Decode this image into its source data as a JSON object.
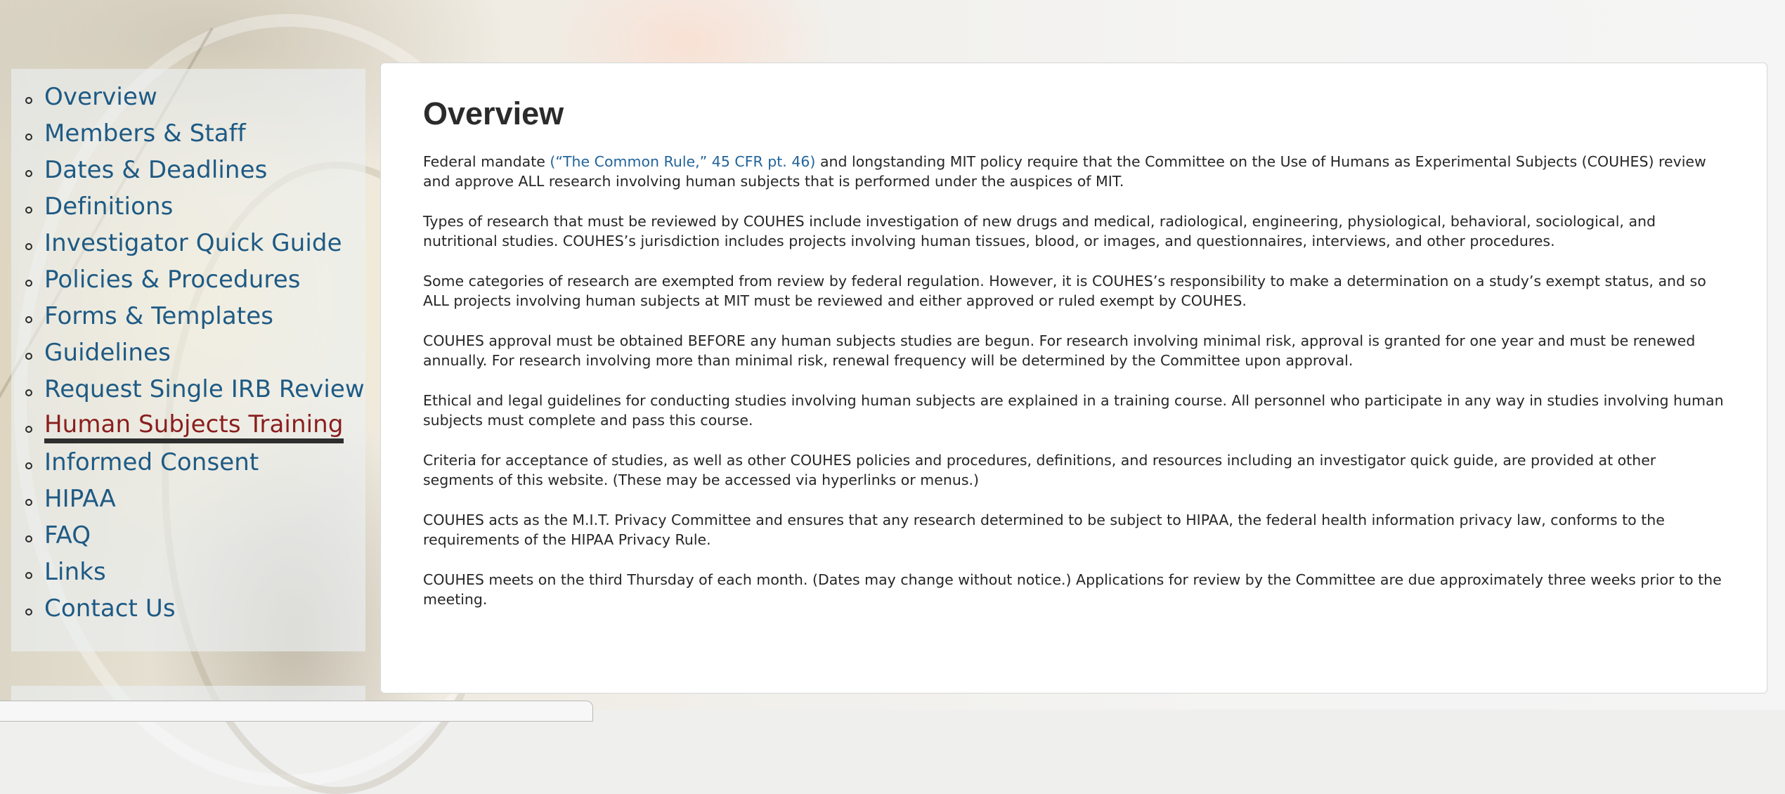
{
  "sidebar": {
    "items": [
      {
        "label": "Overview"
      },
      {
        "label": "Members & Staff"
      },
      {
        "label": "Dates & Deadlines"
      },
      {
        "label": "Definitions"
      },
      {
        "label": "Investigator Quick Guide"
      },
      {
        "label": "Policies & Procedures"
      },
      {
        "label": "Forms & Templates"
      },
      {
        "label": "Guidelines"
      },
      {
        "label": "Request Single IRB Review"
      },
      {
        "label": "Human Subjects Training"
      },
      {
        "label": "Informed Consent"
      },
      {
        "label": "HIPAA"
      },
      {
        "label": "FAQ"
      },
      {
        "label": "Links"
      },
      {
        "label": "Contact Us"
      }
    ],
    "active_item": "Human Subjects Training"
  },
  "main": {
    "title": "Overview",
    "p1": {
      "before": "Federal mandate ",
      "link": "(“The Common Rule,” 45 CFR pt. 46)",
      "after": " and longstanding MIT policy require that the Committee on the Use of Humans as Experimental Subjects (COUHES) review and approve ALL research involving human subjects that is performed under the auspices of MIT."
    },
    "p2": "Types of research that must be reviewed by COUHES include investigation of new drugs and medical, radiological, engineering, physiological, behavioral, sociological, and nutritional studies. COUHES’s jurisdiction includes projects involving human tissues, blood, or images, and questionnaires, interviews, and other procedures.",
    "p3": "Some categories of research are exempted from review by federal regulation. However, it is COUHES’s responsibility to make a determination on a study’s exempt status, and so ALL projects involving human subjects at MIT must be reviewed and either approved or ruled exempt by COUHES.",
    "p4": "COUHES approval must be obtained BEFORE any human subjects studies are begun. For research involving minimal risk, approval is granted for one year and must be renewed annually. For research involving more than minimal risk, renewal frequency will be determined by the Committee upon approval.",
    "p5": "Ethical and legal guidelines for conducting studies involving human subjects are explained in a training course. All personnel who participate in any way in studies involving human subjects must complete and pass this course.",
    "p6": "Criteria for acceptance of studies, as well as other COUHES policies and procedures, definitions, and resources including an investigator quick guide, are provided at other segments of this website. (These may be accessed via hyperlinks or menus.)",
    "p7": "COUHES acts as the M.I.T. Privacy Committee and ensures that any research determined to be subject to HIPAA, the federal health information privacy law, conforms to the requirements of the HIPAA Privacy Rule.",
    "p8": "COUHES meets on the third Thursday of each month. (Dates may change without notice.) Applications for review by the Committee are due approximately three weeks prior to the meeting."
  },
  "colors": {
    "link": "#1e5a84",
    "active": "#8a1e1e",
    "text": "#262626"
  }
}
